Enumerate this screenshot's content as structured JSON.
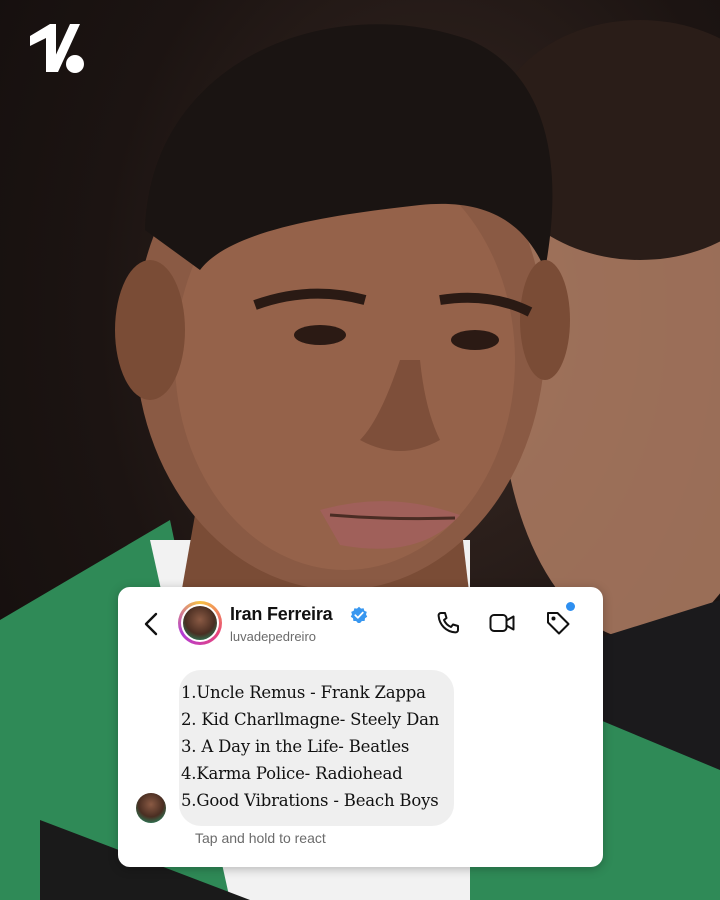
{
  "background": {
    "description_colors": {
      "jacket": "#2f8a57",
      "skin": "#8a5a44",
      "hair": "#1a1412"
    }
  },
  "brand": {
    "logo_icon": "onefootball-logo-icon"
  },
  "dm": {
    "header": {
      "name": "Iran Ferreira",
      "handle": "luvadepedreiro",
      "verified_icon": "verified-badge-icon",
      "icons": [
        "back-chevron-icon",
        "phone-icon",
        "video-camera-icon",
        "tag-icon"
      ]
    },
    "message_lines": [
      "1.Uncle Remus - Frank Zappa",
      "2. Kid Charllmagne- Steely Dan",
      "3. A Day in the Life- Beatles",
      "4.Karma Police- Radiohead",
      "5.Good Vibrations - Beach Boys"
    ],
    "react_hint": "Tap and hold to react"
  }
}
